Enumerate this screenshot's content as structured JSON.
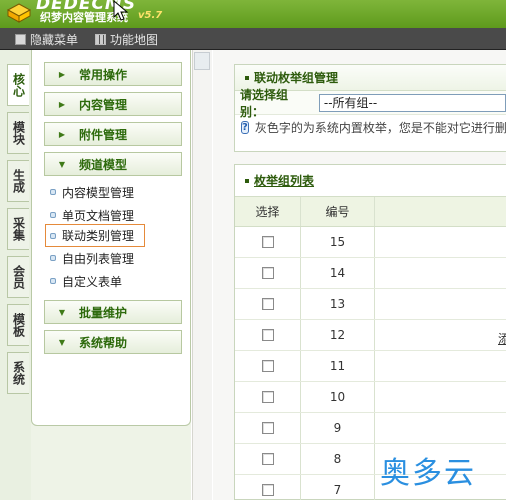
{
  "banner": {
    "logo_title": "DEDECMS",
    "logo_subtitle": "织梦内容管理系统",
    "version": "v5.7"
  },
  "toolbar": {
    "hide_menu": "隐藏菜单",
    "sitemap": "功能地图"
  },
  "vtabs": [
    "核心",
    "模块",
    "生成",
    "采集",
    "会员",
    "模板",
    "系统"
  ],
  "menu": {
    "headers": [
      "常用操作",
      "内容管理",
      "附件管理",
      "频道模型",
      "批量维护",
      "系统帮助"
    ],
    "items": [
      "内容模型管理",
      "单页文档管理",
      "联动类别管理",
      "自由列表管理",
      "自定义表单"
    ],
    "active_item": "联动类别管理"
  },
  "panel1": {
    "title": "联动枚举组管理",
    "select_label": "请选择组别：",
    "select_value": "--所有组--",
    "hint": "灰色字的为系统内置枚举，您是不能对它进行删除的"
  },
  "panel2": {
    "title": "枚举组列表",
    "columns": [
      "选择",
      "编号",
      ""
    ],
    "rows": [
      "15",
      "14",
      "13",
      "12",
      "11",
      "10",
      "9",
      "8",
      "7"
    ],
    "cut_text": "添"
  },
  "watermark": "奥多云",
  "colors": {
    "banner_green": "#6aa626",
    "toolbar_dark": "#4a4a4a",
    "accent_text": "#2d5b0c",
    "active_border": "#e58a3a"
  }
}
